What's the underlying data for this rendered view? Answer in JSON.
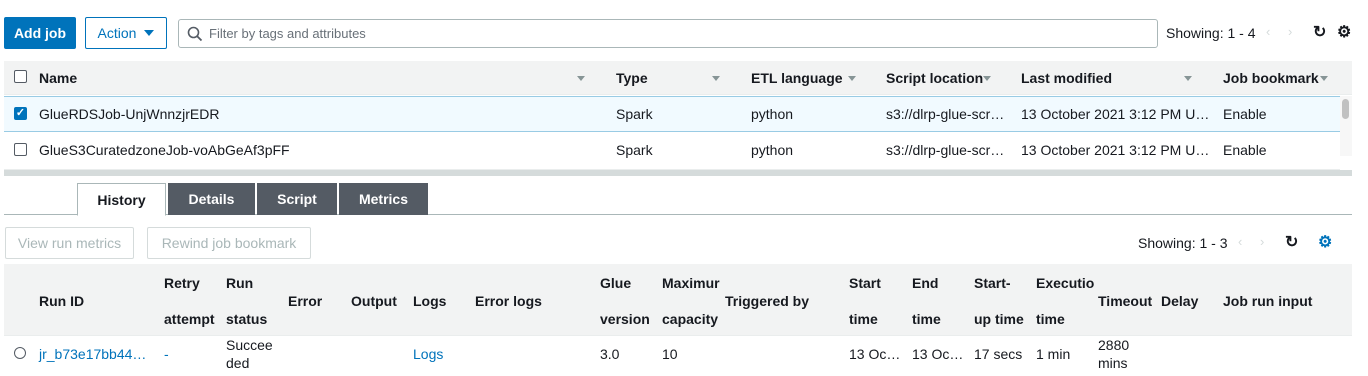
{
  "toolbar": {
    "add_job": "Add job",
    "action": "Action",
    "filter_placeholder": "Filter by tags and attributes",
    "showing": "Showing: 1 - 4",
    "prev": "‹",
    "next": "›",
    "refresh_icon": "↻",
    "settings_icon": "⚙"
  },
  "jobs_table": {
    "headers": {
      "name": "Name",
      "type": "Type",
      "etl_language": "ETL language",
      "script_location": "Script location",
      "last_modified": "Last modified",
      "job_bookmark": "Job bookmark"
    },
    "rows": [
      {
        "selected": true,
        "name": "GlueRDSJob-UnjWnnzjrEDR",
        "type": "Spark",
        "etl_language": "python",
        "script_location": "s3://dlrp-glue-scr…",
        "last_modified": "13 October 2021 3:12 PM U…",
        "job_bookmark": "Enable"
      },
      {
        "selected": false,
        "name": "GlueS3CuratedzoneJob-voAbGeAf3pFF",
        "type": "Spark",
        "etl_language": "python",
        "script_location": "s3://dlrp-glue-scr…",
        "last_modified": "13 October 2021 3:12 PM U…",
        "job_bookmark": "Enable"
      }
    ]
  },
  "tabs": [
    "History",
    "Details",
    "Script",
    "Metrics"
  ],
  "history": {
    "view_run_metrics": "View run metrics",
    "rewind_job_bookmark": "Rewind job bookmark",
    "showing": "Showing: 1 - 3",
    "prev": "‹",
    "next": "›",
    "refresh_icon": "↻",
    "settings_icon": "⚙",
    "headers": {
      "run_id": "Run ID",
      "retry_1": "Retry",
      "retry_2": "attempt",
      "run_status_1": "Run",
      "run_status_2": "status",
      "error": "Error",
      "output": "Output",
      "logs": "Logs",
      "error_logs": "Error logs",
      "glue_version_1": "Glue",
      "glue_version_2": "version",
      "max_capacity_1": "Maximur",
      "max_capacity_2": "capacity",
      "triggered_by": "Triggered by",
      "start_time_1": "Start",
      "start_time_2": "time",
      "end_time_1": "End",
      "end_time_2": "time",
      "startup_time_1": "Start-",
      "startup_time_2": "up time",
      "execution_time_1": "Executio",
      "execution_time_2": "time",
      "timeout": "Timeout",
      "delay": "Delay",
      "job_run_input": "Job run input"
    },
    "rows": [
      {
        "run_id": "jr_b73e17bb44…",
        "retry_attempt": "-",
        "run_status_1": "Succee",
        "run_status_2": "ded",
        "logs": "Logs",
        "glue_version": "3.0",
        "max_capacity": "10",
        "start_time": "13 Oc…",
        "end_time": "13 Oc…",
        "startup_time": "17 secs",
        "execution_time": "1 min",
        "timeout_1": "2880",
        "timeout_2": "mins"
      }
    ]
  },
  "colors": {
    "primary": "#0073bb",
    "header_bg": "#f2f3f3",
    "selected_row_bg": "#f1faff",
    "tab_inactive_bg": "#545b64"
  }
}
